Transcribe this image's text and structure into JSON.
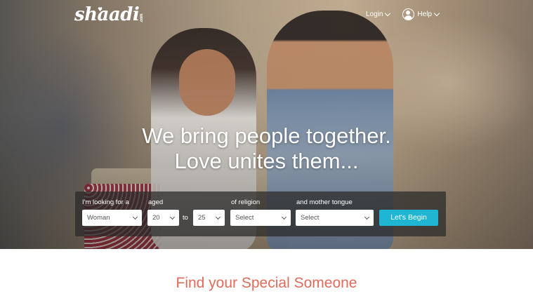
{
  "brand": {
    "logo_text": "shaadi",
    "logo_suffix": ".com"
  },
  "nav": {
    "login_label": "Login",
    "help_label": "Help"
  },
  "hero": {
    "headline_line1": "We bring people together.",
    "headline_line2": "Love unites them..."
  },
  "search": {
    "looking_for_label": "I'm looking for a",
    "looking_for_value": "Woman",
    "aged_label": "aged",
    "age_min": "20",
    "to_label": "to",
    "age_max": "25",
    "religion_label": "of religion",
    "religion_value": "Select",
    "tongue_label": "and mother tongue",
    "tongue_value": "Select",
    "submit_label": "Let's Begin"
  },
  "section": {
    "tagline": "Find your Special Someone"
  },
  "colors": {
    "accent": "#1fb6d4",
    "tagline": "#e06b5b"
  },
  "icons": [
    "heart-icon",
    "avatar-icon",
    "chevron-down-icon"
  ]
}
